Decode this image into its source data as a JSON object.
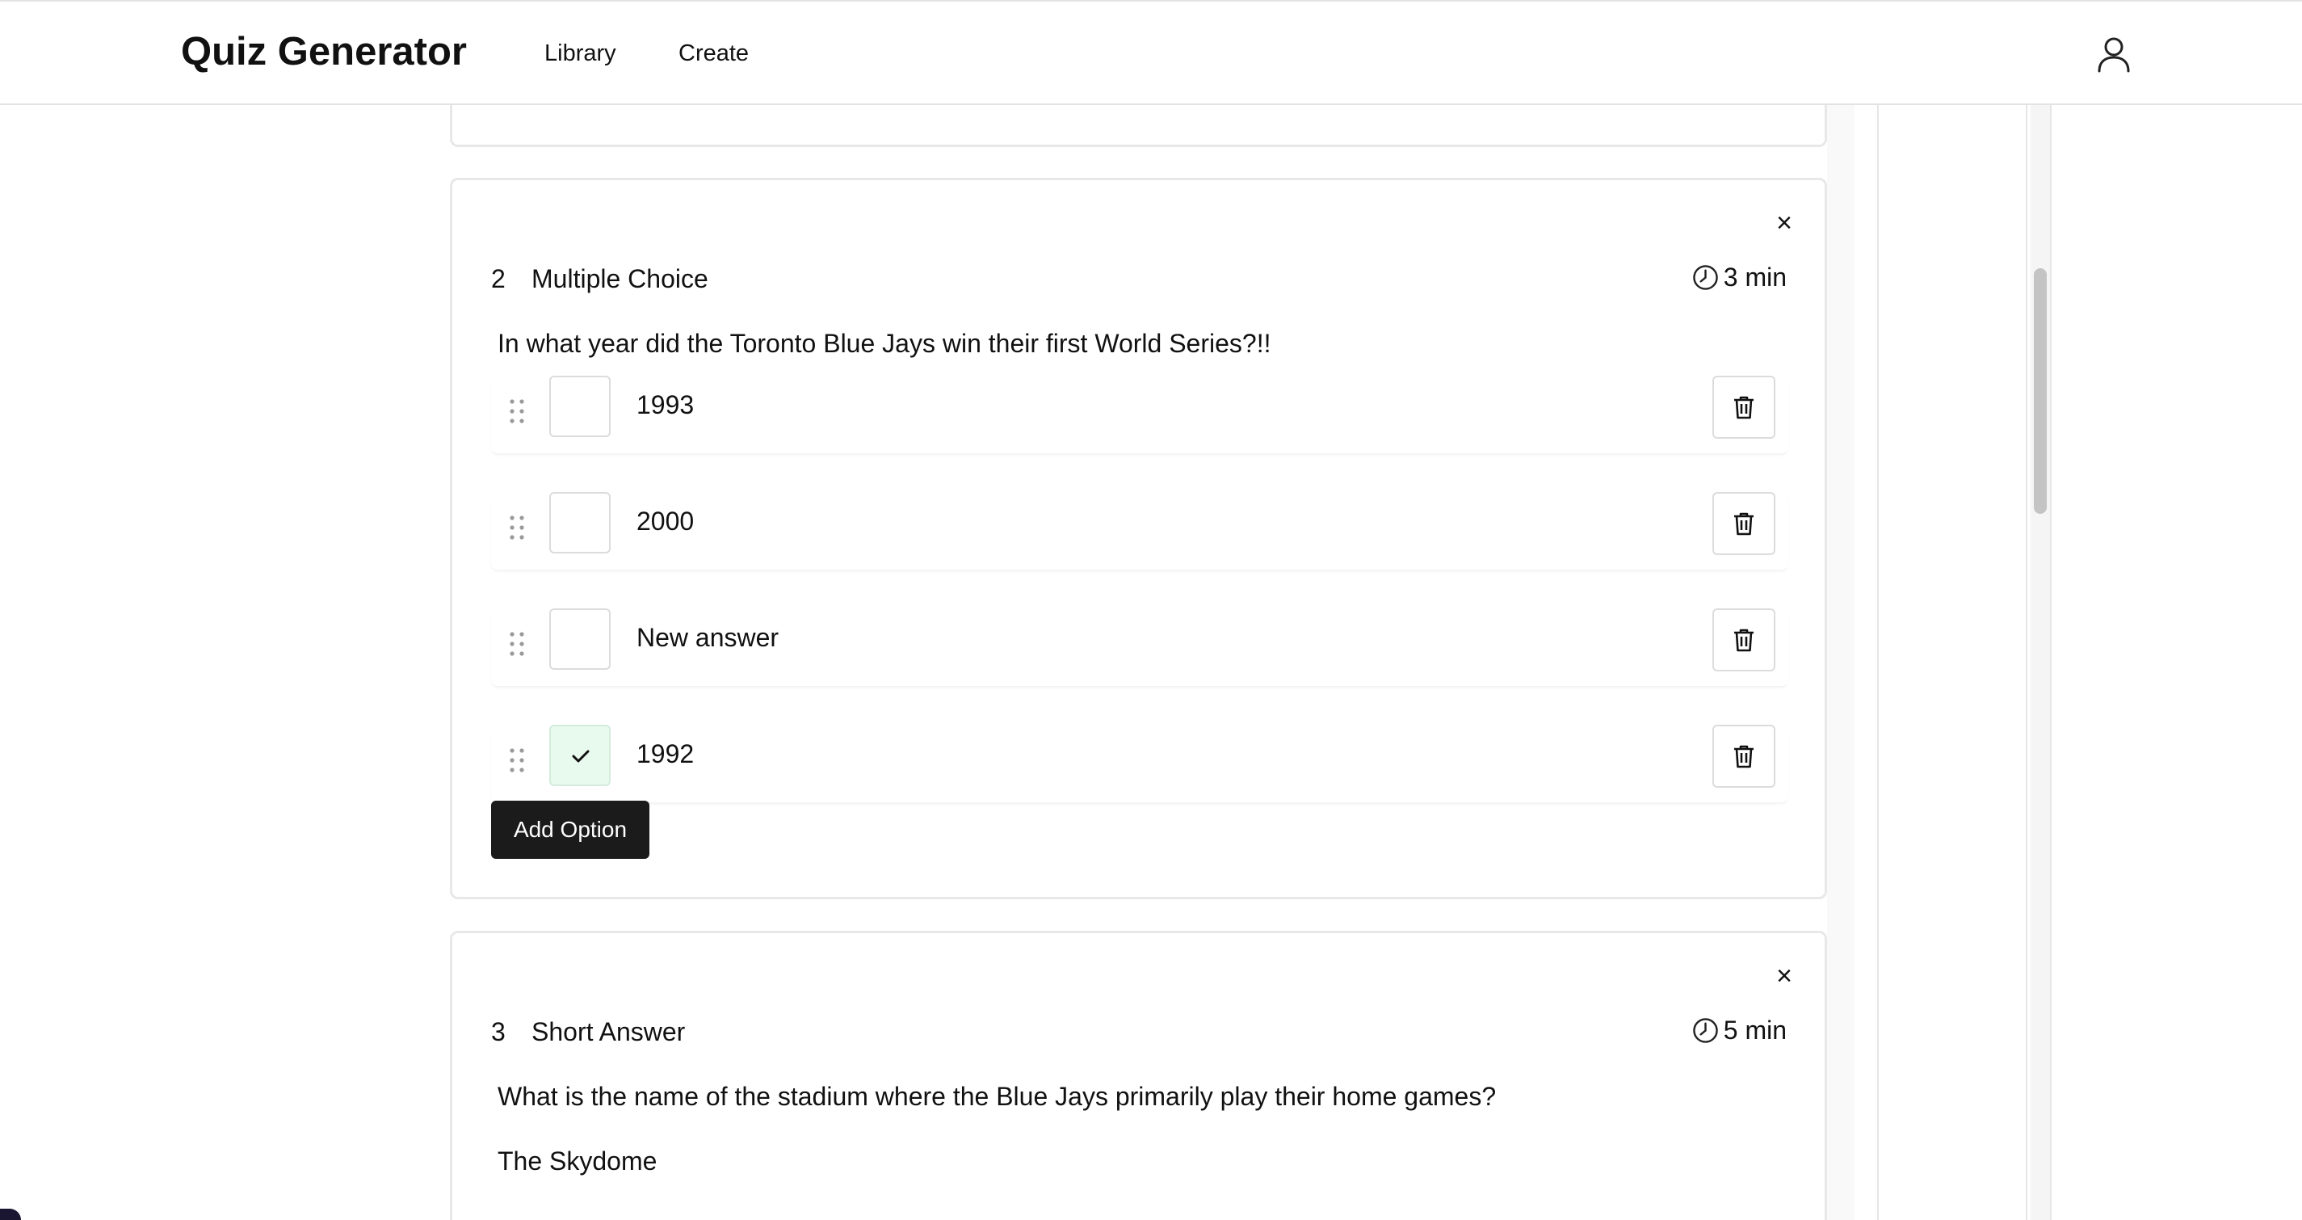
{
  "header": {
    "app_title": "Quiz Generator",
    "nav": [
      {
        "label": "Library"
      },
      {
        "label": "Create"
      }
    ],
    "user_icon": "user-icon"
  },
  "questions": [
    {
      "number": "2",
      "type": "Multiple Choice",
      "time": "3 min",
      "text": "In what year did the Toronto Blue Jays win their first World Series?!!",
      "options": [
        {
          "label": "1993",
          "correct": false
        },
        {
          "label": "2000",
          "correct": false
        },
        {
          "label": "New answer",
          "correct": false
        },
        {
          "label": "1992",
          "correct": true
        }
      ],
      "add_option_label": "Add Option",
      "close_glyph": "×"
    },
    {
      "number": "3",
      "type": "Short Answer",
      "time": "5 min",
      "text": "What is the name of the stadium where the Blue Jays primarily play their home games?",
      "answer": "The Skydome",
      "close_glyph": "×"
    }
  ],
  "colors": {
    "accent_dark": "#1b1b1b",
    "correct_bg": "#e8f9ee",
    "border": "#e8e8e8"
  }
}
